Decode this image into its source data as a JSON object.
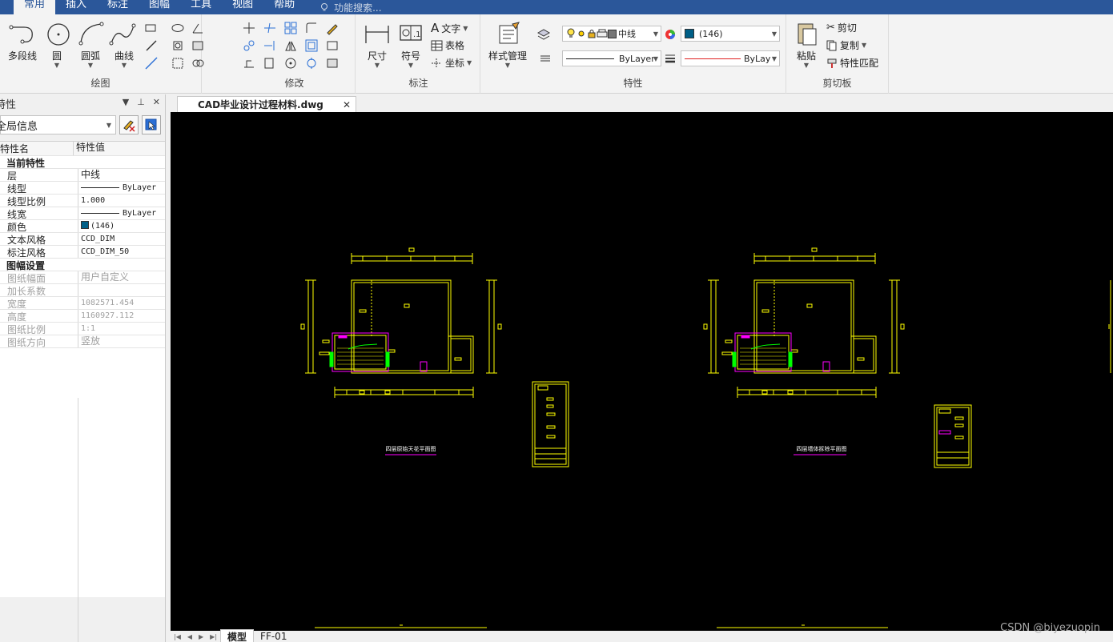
{
  "menubar": {
    "tabs": [
      "常用",
      "插入",
      "标注",
      "图幅",
      "工具",
      "视图",
      "帮助"
    ],
    "active_tab": "常用",
    "search_placeholder": "功能搜索..."
  },
  "ribbon": {
    "draw": {
      "label": "绘图",
      "buttons": [
        "多段线",
        "圆",
        "圆弧",
        "曲线"
      ]
    },
    "modify": {
      "label": "修改"
    },
    "annotate": {
      "label": "标注",
      "buttons": [
        "尺寸",
        "符号"
      ],
      "small": [
        "文字",
        "表格",
        "坐标"
      ]
    },
    "properties": {
      "label": "特性",
      "style_button": "样式管理",
      "layer_value": "中线",
      "color_value": "(146)",
      "linetype_value": "ByLayer",
      "lineweight_value": "ByLayer"
    },
    "clipboard": {
      "label": "剪切板",
      "paste": "粘贴",
      "cut": "剪切",
      "copy": "复制",
      "match": "特性匹配"
    }
  },
  "props_panel": {
    "title": "特性",
    "selector": "全局信息",
    "header": {
      "name": "特性名",
      "value": "特性值"
    },
    "sections": [
      {
        "title": "当前特性",
        "rows": [
          {
            "name": "层",
            "value": "中线"
          },
          {
            "name": "线型",
            "value": "ByLayer"
          },
          {
            "name": "线型比例",
            "value": "1.000"
          },
          {
            "name": "线宽",
            "value": "ByLayer"
          },
          {
            "name": "颜色",
            "value": "(146)"
          },
          {
            "name": "文本风格",
            "value": "CCD_DIM"
          },
          {
            "name": "标注风格",
            "value": "CCD_DIM_50"
          }
        ]
      },
      {
        "title": "图幅设置",
        "rows": [
          {
            "name": "图纸幅面",
            "value": "用户自定义"
          },
          {
            "name": "加长系数",
            "value": ""
          },
          {
            "name": "宽度",
            "value": "1082571.454"
          },
          {
            "name": "高度",
            "value": "1160927.112"
          },
          {
            "name": "图纸比例",
            "value": "1:1"
          },
          {
            "name": "图纸方向",
            "value": "竖放"
          }
        ]
      }
    ]
  },
  "document": {
    "tab_title": "CAD毕业设计过程材料.dwg"
  },
  "drawing": {
    "left_title": "四层原始天花平面图",
    "right_title": "四层墙体拆除平面图"
  },
  "layout_tabs": [
    "模型",
    "FF-01"
  ],
  "active_layout": "模型",
  "watermark": "CSDN @biyezuopin",
  "colors": {
    "menubar": "#2b579a",
    "cad_yellow": "#ffff00",
    "cad_magenta": "#ff00ff",
    "cad_green": "#00ff00",
    "cad_color_146": "#005f87"
  }
}
